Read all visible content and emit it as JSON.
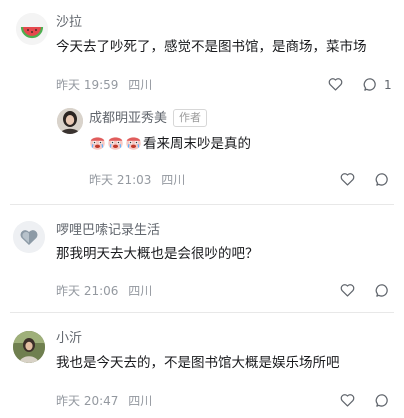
{
  "comments": [
    {
      "user": "沙拉",
      "text": "今天去了吵死了，感觉不是图书馆，是商场，菜市场",
      "time": "昨天 19:59",
      "location": "四川",
      "reply_count": "1",
      "replies": [
        {
          "user": "成都明亚秀美",
          "author_tag": "作者",
          "text": "看来周末吵是真的",
          "time": "昨天 21:03",
          "location": "四川"
        }
      ]
    },
    {
      "user": "啰哩巴嗦记录生活",
      "text": "那我明天去大概也是会很吵的吧？",
      "time": "昨天 21:06",
      "location": "四川"
    },
    {
      "user": "小沂",
      "text": "我也是今天去的，不是图书馆大概是娱乐场所吧",
      "time": "昨天 20:47",
      "location": "四川"
    }
  ],
  "icons": {
    "like": "heart-outline-icon",
    "reply": "speech-bubble-icon",
    "emoji": "crying-face-emoji"
  }
}
